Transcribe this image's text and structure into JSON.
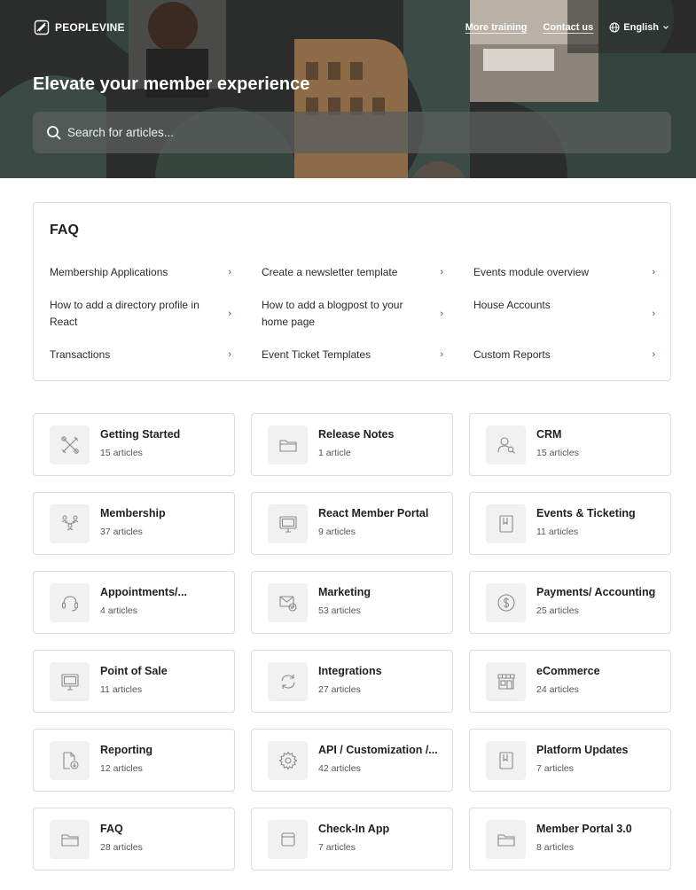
{
  "header": {
    "logo_text": "PEOPLEVINE",
    "nav": [
      {
        "label": "More training"
      },
      {
        "label": "Contact us"
      }
    ],
    "language": "English",
    "hero_title": "Elevate your member experience",
    "search_placeholder": "Search for articles..."
  },
  "faq": {
    "title": "FAQ",
    "items": [
      {
        "label": "Membership Applications"
      },
      {
        "label": "Create a newsletter template"
      },
      {
        "label": "Events module overview"
      },
      {
        "label": "How to add a directory profile in React"
      },
      {
        "label": "How to add a blogpost to your home page"
      },
      {
        "label": "House Accounts"
      },
      {
        "label": "Transactions"
      },
      {
        "label": "Event Ticket Templates"
      },
      {
        "label": "Custom Reports"
      }
    ]
  },
  "categories": [
    {
      "title": "Getting Started",
      "count": "15 articles",
      "icon": "tools-icon"
    },
    {
      "title": "Release Notes",
      "count": "1 article",
      "icon": "folder-icon"
    },
    {
      "title": "CRM",
      "count": "15 articles",
      "icon": "user-search-icon"
    },
    {
      "title": "Membership",
      "count": "37 articles",
      "icon": "people-network-icon"
    },
    {
      "title": "React Member Portal",
      "count": "9 articles",
      "icon": "monitor-icon"
    },
    {
      "title": "Events & Ticketing",
      "count": "11 articles",
      "icon": "bookmark-icon"
    },
    {
      "title": "Appointments/...",
      "count": "4 articles",
      "icon": "headset-icon"
    },
    {
      "title": "Marketing",
      "count": "53 articles",
      "icon": "mail-check-icon"
    },
    {
      "title": "Payments/ Accounting",
      "count": "25 articles",
      "icon": "dollar-icon"
    },
    {
      "title": "Point of Sale",
      "count": "11 articles",
      "icon": "monitor-icon"
    },
    {
      "title": "Integrations",
      "count": "27 articles",
      "icon": "sync-icon"
    },
    {
      "title": "eCommerce",
      "count": "24 articles",
      "icon": "store-icon"
    },
    {
      "title": "Reporting",
      "count": "12 articles",
      "icon": "file-download-icon"
    },
    {
      "title": "API / Customization /...",
      "count": "42 articles",
      "icon": "gear-icon"
    },
    {
      "title": "Platform Updates",
      "count": "7 articles",
      "icon": "bookmark-icon"
    },
    {
      "title": "FAQ",
      "count": "28 articles",
      "icon": "folder-icon"
    },
    {
      "title": "Check-In App",
      "count": "7 articles",
      "icon": "window-icon"
    },
    {
      "title": "Member Portal 3.0",
      "count": "8 articles",
      "icon": "folder-icon"
    }
  ]
}
